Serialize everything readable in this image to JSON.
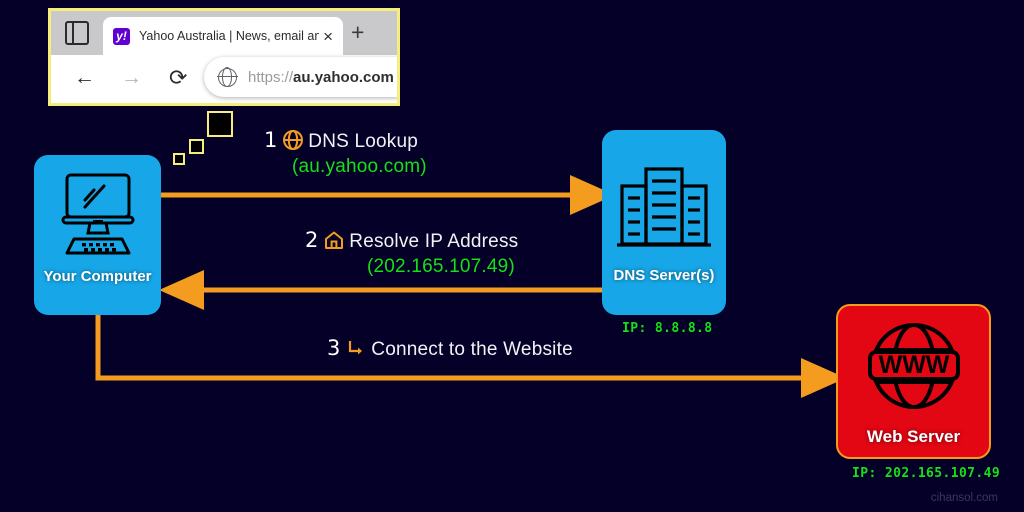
{
  "colors": {
    "background": "#040028",
    "node_blue": "#17a7e8",
    "node_red": "#e30613",
    "arrow_orange": "#f39c1f",
    "accent_green": "#16e016",
    "callout_border": "#f5ee7a",
    "label_white": "#f2f2f5"
  },
  "browser": {
    "tab": {
      "favicon_letter": "y!",
      "title": "Yahoo Australia | News, email an",
      "close_label": "×"
    },
    "new_tab_label": "+",
    "nav": {
      "back_label": "←",
      "forward_label": "→",
      "reload_label": "⟳"
    },
    "url": {
      "scheme": "https://",
      "host": "au.yahoo.com"
    }
  },
  "nodes": [
    {
      "id": "computer",
      "label": "Your Computer",
      "icon": "desktop-computer-icon"
    },
    {
      "id": "dns",
      "label": "DNS Server(s)",
      "icon": "server-buildings-icon",
      "ip": "IP:  8.8.8.8"
    },
    {
      "id": "web",
      "label": "Web Server",
      "icon": "www-globe-icon",
      "ip": "IP:  202.165.107.49"
    }
  ],
  "steps": [
    {
      "num": "1",
      "icon": "globe-icon",
      "title": "DNS Lookup",
      "sub": "(au.yahoo.com)"
    },
    {
      "num": "2",
      "icon": "home-icon",
      "title": "Resolve IP Address",
      "sub": "(202.165.107.49)"
    },
    {
      "num": "3",
      "icon": "arrow-turn-icon",
      "title": "Connect to the Website",
      "sub": ""
    }
  ],
  "watermark": "cihansol.com"
}
